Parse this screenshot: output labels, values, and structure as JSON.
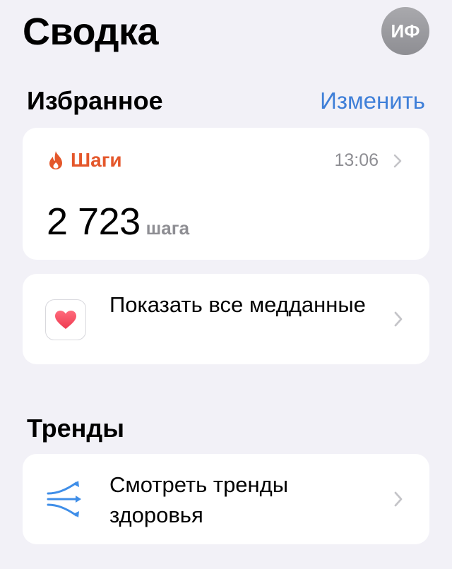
{
  "header": {
    "title": "Сводка",
    "avatar_initials": "ИФ"
  },
  "favorites": {
    "title": "Избранное",
    "edit_label": "Изменить",
    "steps": {
      "label": "Шаги",
      "time": "13:06",
      "value": "2 723",
      "unit": "шага",
      "accent_color": "#e4572b"
    },
    "show_all_label": "Показать все медданные"
  },
  "trends": {
    "title": "Тренды",
    "view_label": "Смотреть тренды здоровья"
  },
  "icons": {
    "avatar": "avatar-initials",
    "steps": "flame-icon",
    "health": "heart-icon",
    "trends": "trend-arrows-icon",
    "chevron": "chevron-right-icon"
  },
  "colors": {
    "background": "#f2f1f7",
    "link": "#3f7fd8",
    "secondary_text": "#8e8e93",
    "heart": "#f04b5f"
  }
}
